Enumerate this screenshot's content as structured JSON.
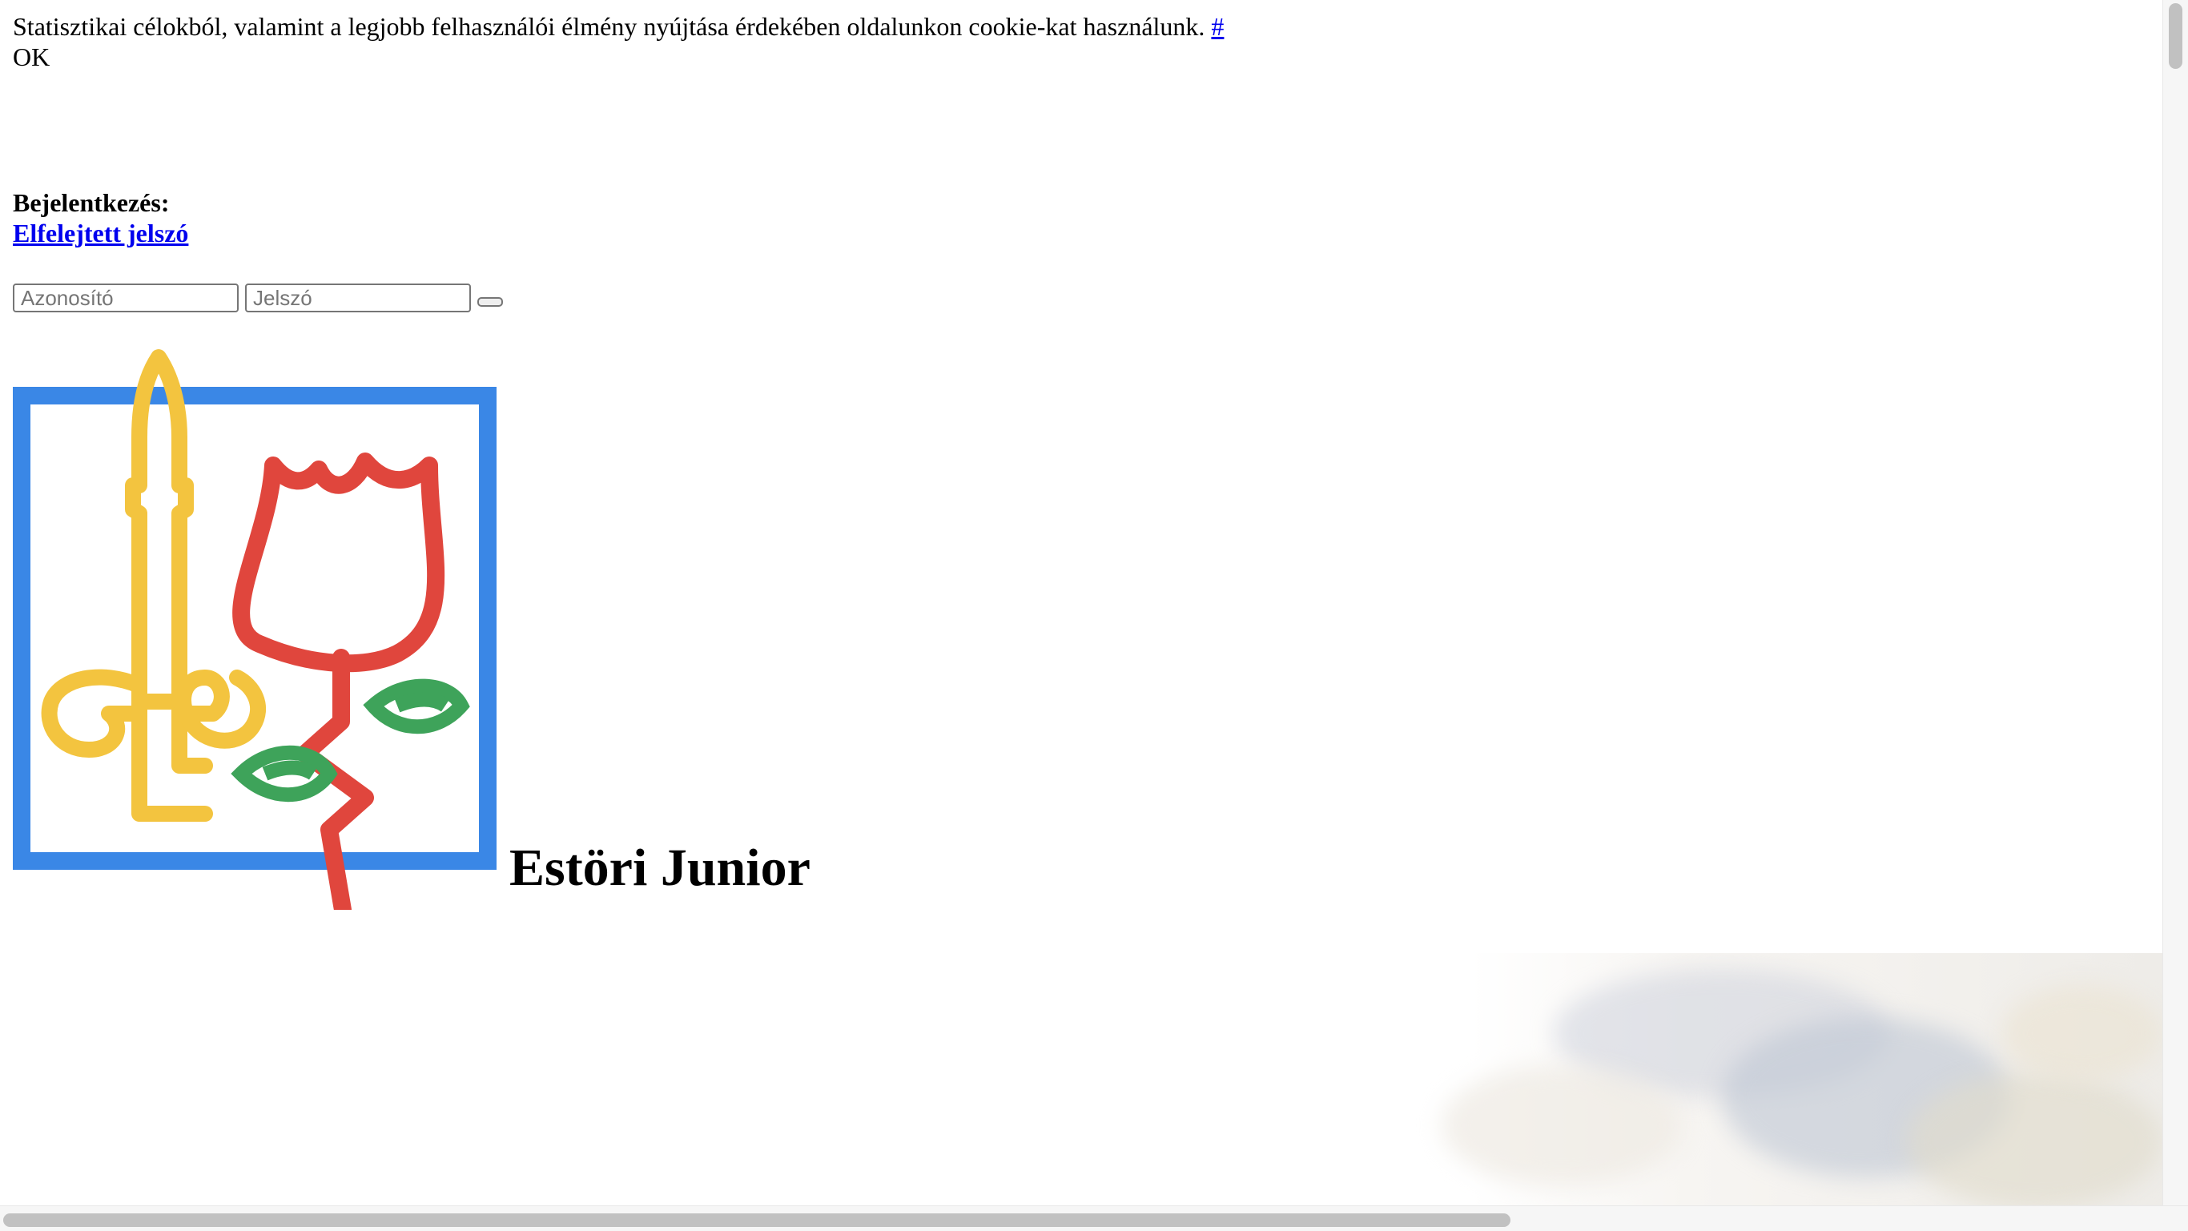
{
  "cookie_notice": {
    "text": "Statisztikai célokból, valamint a legjobb felhasználói élmény nyújtása érdekében oldalunkon cookie-kat használunk.",
    "link_label": "#",
    "ok_label": "OK"
  },
  "login": {
    "title": "Bejelentkezés:",
    "forgot_password_label": "Elfelejtett jelszó",
    "username_placeholder": "Azonosító",
    "password_placeholder": "Jelszó",
    "submit_label": ""
  },
  "brand": {
    "logo_icon": "sword-and-tulip-logo-icon",
    "title": "Estöri Junior",
    "colors": {
      "frame_blue": "#3a87e6",
      "sword_yellow": "#f3c43f",
      "tulip_red": "#e0463d",
      "leaf_green": "#3ea35a"
    }
  },
  "hero": {
    "image": "cloudy-sky-image"
  },
  "scrollbars": {
    "vertical": "vertical-scrollbar",
    "horizontal": "horizontal-scrollbar"
  }
}
